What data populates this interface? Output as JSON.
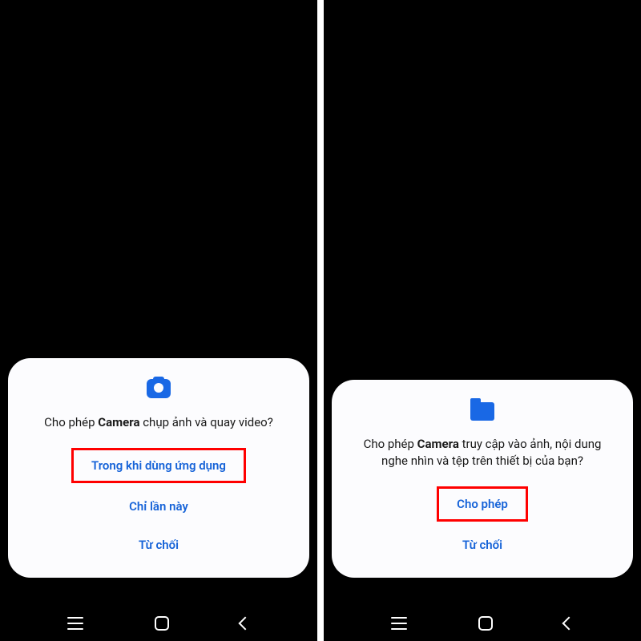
{
  "screens": [
    {
      "icon": "camera",
      "message_prefix": "Cho phép ",
      "message_bold": "Camera",
      "message_suffix": " chụp ảnh và quay video?",
      "buttons": [
        {
          "label": "Trong khi dùng ứng dụng",
          "highlighted": true
        },
        {
          "label": "Chỉ lần này",
          "highlighted": false
        },
        {
          "label": "Từ chối",
          "highlighted": false
        }
      ]
    },
    {
      "icon": "folder",
      "message_prefix": "Cho phép ",
      "message_bold": "Camera",
      "message_suffix": " truy cập vào ảnh, nội dung nghe nhìn và tệp trên thiết bị của bạn?",
      "buttons": [
        {
          "label": "Cho phép",
          "highlighted": true
        },
        {
          "label": "Từ chối",
          "highlighted": false
        }
      ]
    }
  ],
  "colors": {
    "accent": "#1968e5",
    "highlight": "#ff0000",
    "dialog_bg": "#fcfcfe"
  }
}
